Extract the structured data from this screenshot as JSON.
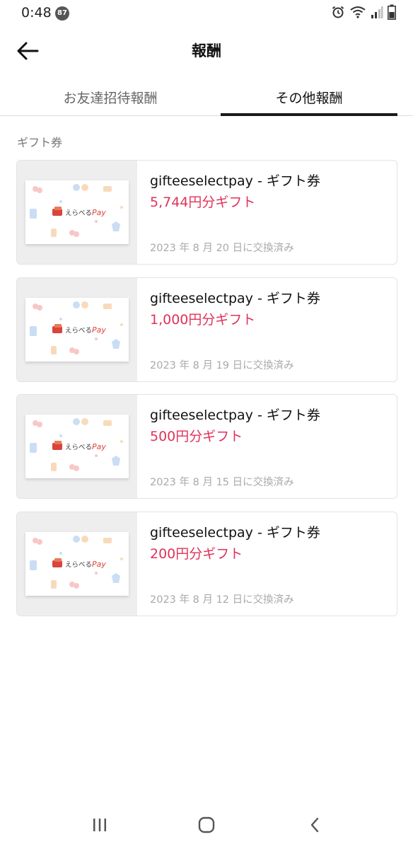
{
  "status": {
    "time": "0:48",
    "notification_count": "87"
  },
  "header": {
    "title": "報酬"
  },
  "tabs": [
    {
      "label": "お友達招待報酬"
    },
    {
      "label": "その他報酬"
    }
  ],
  "section": {
    "label": "ギフト券"
  },
  "gift_card_logo": {
    "text": "えらべる Pay"
  },
  "rewards": [
    {
      "title": "gifteeselectpay - ギフト券",
      "amount": "5,744円分ギフト",
      "date": "2023 年 8 月 20 日に交換済み"
    },
    {
      "title": "gifteeselectpay - ギフト券",
      "amount": "1,000円分ギフト",
      "date": "2023 年 8 月 19 日に交換済み"
    },
    {
      "title": "gifteeselectpay - ギフト券",
      "amount": "500円分ギフト",
      "date": "2023 年 8 月 15 日に交換済み"
    },
    {
      "title": "gifteeselectpay - ギフト券",
      "amount": "200円分ギフト",
      "date": "2023 年 8 月 12 日に交換済み"
    }
  ],
  "colors": {
    "accent": "#e0325a",
    "text": "#111111",
    "muted": "#a9a9a9"
  },
  "icons": {
    "back": "arrow-left-icon",
    "alarm": "alarm-icon",
    "wifi": "wifi-icon",
    "signal": "signal-icon",
    "battery": "battery-icon",
    "recents": "recents-icon",
    "home": "home-icon",
    "nav_back": "chevron-left-icon"
  }
}
